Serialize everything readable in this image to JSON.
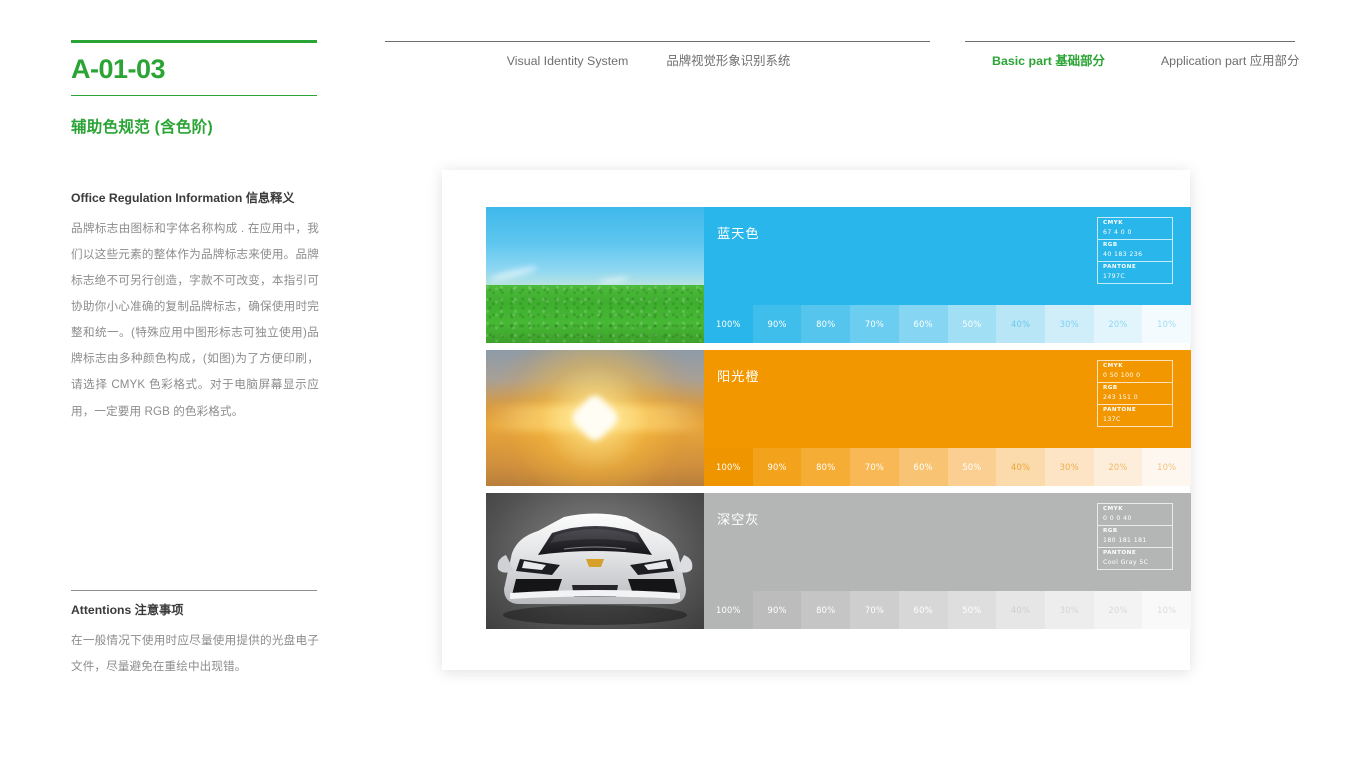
{
  "header": {
    "links_left": [
      {
        "label": "Visual Identity System",
        "active": false
      },
      {
        "label": "品牌视觉形象识别系统",
        "active": false
      }
    ],
    "links_right": [
      {
        "label": "Basic part 基础部分",
        "active": true
      },
      {
        "label": "Application part 应用部分",
        "active": false
      }
    ],
    "accent_color": "#2aa434",
    "muted_color": "#6e6e6e"
  },
  "sidebar": {
    "page_code": "A-01-03",
    "section_title": "辅助色规范 (含色阶)",
    "info": {
      "heading": "Office Regulation Information  信息释义",
      "body": "品牌标志由图标和字体名称构成 . 在应用中，我们以这些元素的整体作为品牌标志来使用。品牌标志绝不可另行创造，字款不可改变，本指引可协助你小心准确的复制品牌标志，确保使用时完整和统一。(特殊应用中图形标志可独立使用)品牌标志由多种颜色构成，(如图)为了方便印刷，请选择 CMYK 色彩格式。对于电脑屏幕显示应用，一定要用 RGB 的色彩格式。"
    },
    "attentions": {
      "heading": "Attentions 注意事项",
      "body": "在一般情况下使用时应尽量使用提供的光盘电子文件，尽量避免在重绘中出现错。"
    }
  },
  "tint_labels": [
    "100%",
    "90%",
    "80%",
    "70%",
    "60%",
    "50%",
    "40%",
    "30%",
    "20%",
    "10%"
  ],
  "colors": [
    {
      "name": "蓝天色",
      "photo": "sky-grass-photo",
      "hex": "#29b6ea",
      "spec": [
        {
          "label": "CMYK",
          "value": "67 4 0 0"
        },
        {
          "label": "RGB",
          "value": "40 183 236"
        },
        {
          "label": "PANTONE",
          "value": "1797C"
        }
      ],
      "tints": [
        {
          "bg": "#29b6ea",
          "fg": "#ffffff"
        },
        {
          "bg": "#3fbeec",
          "fg": "#ffffff"
        },
        {
          "bg": "#55c5ee",
          "fg": "#ffffff"
        },
        {
          "bg": "#6bcdf0",
          "fg": "#ffffff"
        },
        {
          "bg": "#86d6f3",
          "fg": "#ffffff"
        },
        {
          "bg": "#a1dff5",
          "fg": "#ffffff"
        },
        {
          "bg": "#b9e6f7",
          "fg": "#6cc9ee"
        },
        {
          "bg": "#cfeefa",
          "fg": "#7fd0ef"
        },
        {
          "bg": "#e3f5fc",
          "fg": "#90d6f1"
        },
        {
          "bg": "#f3fbfe",
          "fg": "#9fdbf3"
        }
      ]
    },
    {
      "name": "阳光橙",
      "photo": "sunset-photo",
      "hex": "#f39700",
      "spec": [
        {
          "label": "CMYK",
          "value": "0 50 100 0"
        },
        {
          "label": "RGB",
          "value": "243 151 0"
        },
        {
          "label": "PANTONE",
          "value": "137C"
        }
      ],
      "tints": [
        {
          "bg": "#ef9500",
          "fg": "#ffffff"
        },
        {
          "bg": "#f3a21b",
          "fg": "#ffffff"
        },
        {
          "bg": "#f5ad36",
          "fg": "#ffffff"
        },
        {
          "bg": "#f7b855",
          "fg": "#ffffff"
        },
        {
          "bg": "#f8c473",
          "fg": "#ffffff"
        },
        {
          "bg": "#facf91",
          "fg": "#ffffff"
        },
        {
          "bg": "#fbdaac",
          "fg": "#eda63a"
        },
        {
          "bg": "#fce4c4",
          "fg": "#eeae51"
        },
        {
          "bg": "#fdeedc",
          "fg": "#f0b763"
        },
        {
          "bg": "#fef7ef",
          "fg": "#f2c078"
        }
      ]
    },
    {
      "name": "深空灰",
      "photo": "car-photo",
      "hex": "#b4b5b5",
      "spec": [
        {
          "label": "CMYK",
          "value": "0  0  0  40"
        },
        {
          "label": "RGB",
          "value": "180 181 181"
        },
        {
          "label": "PANTONE",
          "value": "Cool Gray 5C"
        }
      ],
      "tints": [
        {
          "bg": "#b4b5b5",
          "fg": "#ffffff"
        },
        {
          "bg": "#bcbcbc",
          "fg": "#ffffff"
        },
        {
          "bg": "#c5c5c5",
          "fg": "#ffffff"
        },
        {
          "bg": "#cecece",
          "fg": "#ffffff"
        },
        {
          "bg": "#d7d7d7",
          "fg": "#ffffff"
        },
        {
          "bg": "#dedede",
          "fg": "#ffffff"
        },
        {
          "bg": "#e6e6e6",
          "fg": "#cfcfcf"
        },
        {
          "bg": "#ededed",
          "fg": "#d4d4d4"
        },
        {
          "bg": "#f3f3f3",
          "fg": "#d9d9d9"
        },
        {
          "bg": "#f9f9f9",
          "fg": "#dcdcdc"
        }
      ]
    }
  ]
}
